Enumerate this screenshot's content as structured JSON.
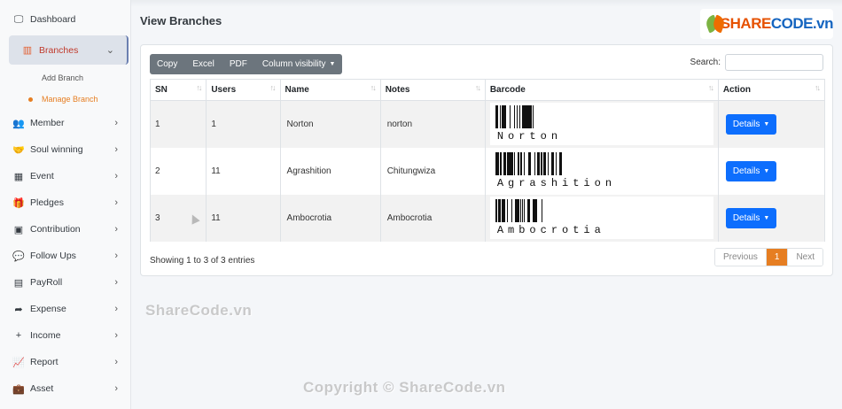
{
  "sidebar": {
    "items": [
      {
        "label": "Dashboard",
        "icon": "monitor-icon",
        "glyph": "🖵",
        "chevron": false
      },
      {
        "label": "Branches",
        "icon": "building-icon",
        "glyph": "▥",
        "chevron": true,
        "expanded": true
      },
      {
        "label": "Member",
        "icon": "users-icon",
        "glyph": "👥",
        "chevron": true
      },
      {
        "label": "Soul winning",
        "icon": "handshake-icon",
        "glyph": "🤝",
        "chevron": true
      },
      {
        "label": "Event",
        "icon": "calendar-icon",
        "glyph": "▦",
        "chevron": true
      },
      {
        "label": "Pledges",
        "icon": "gift-icon",
        "glyph": "🎁",
        "chevron": true
      },
      {
        "label": "Contribution",
        "icon": "money-icon",
        "glyph": "▣",
        "chevron": true
      },
      {
        "label": "Follow Ups",
        "icon": "comments-icon",
        "glyph": "💬",
        "chevron": true
      },
      {
        "label": "PayRoll",
        "icon": "receipt-icon",
        "glyph": "▤",
        "chevron": true
      },
      {
        "label": "Expense",
        "icon": "share-icon",
        "glyph": "➦",
        "chevron": true
      },
      {
        "label": "Income",
        "icon": "plus-icon",
        "glyph": "+",
        "chevron": true
      },
      {
        "label": "Report",
        "icon": "chart-icon",
        "glyph": "📈",
        "chevron": true
      },
      {
        "label": "Asset",
        "icon": "briefcase-icon",
        "glyph": "💼",
        "chevron": true
      }
    ],
    "branches_sub": [
      {
        "label": "Add Branch",
        "current": false
      },
      {
        "label": "Manage Branch",
        "current": true
      }
    ]
  },
  "page": {
    "title": "View Branches"
  },
  "logo": {
    "part1": "SHARE",
    "part2": "CODE.vn"
  },
  "toolbar": {
    "copy": "Copy",
    "excel": "Excel",
    "pdf": "PDF",
    "colvis": "Column visibility"
  },
  "search": {
    "label": "Search:",
    "value": ""
  },
  "table": {
    "headers": [
      "SN",
      "Users",
      "Name",
      "Notes",
      "Barcode",
      "Action"
    ],
    "rows": [
      {
        "sn": "1",
        "users": "1",
        "name": "Norton",
        "notes": "norton",
        "barcode": "Norton",
        "action": "Details"
      },
      {
        "sn": "2",
        "users": "11",
        "name": "Agrashition",
        "notes": "Chitungwiza",
        "barcode": "Agrashition",
        "action": "Details"
      },
      {
        "sn": "3",
        "users": "11",
        "name": "Ambocrotia",
        "notes": "Ambocrotia",
        "barcode": "Ambocrotia",
        "action": "Details"
      }
    ]
  },
  "footer": {
    "info": "Showing 1 to 3 of 3 entries",
    "previous": "Previous",
    "page": "1",
    "next": "Next"
  },
  "watermarks": {
    "mid": "ShareCode.vn",
    "bottom": "Copyright © ShareCode.vn"
  },
  "colors": {
    "accent": "#e67e22",
    "primary": "#0d6efd",
    "toolbar": "#6c757d"
  }
}
